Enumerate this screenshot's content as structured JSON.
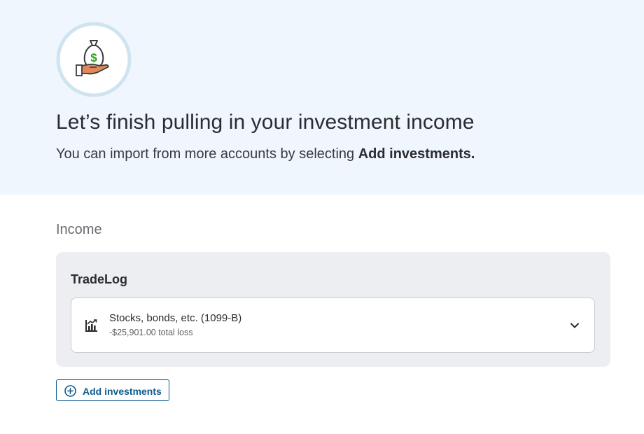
{
  "hero": {
    "icon": "money-bag-hand-icon",
    "title": "Let’s finish pulling in your investment income",
    "subtitle_prefix": "You can import from more accounts by selecting ",
    "subtitle_bold": "Add investments."
  },
  "income": {
    "section_label": "Income",
    "provider": "TradeLog",
    "items": [
      {
        "icon": "stock-chart-icon",
        "title": "Stocks, bonds, etc. (1099-B)",
        "detail": "-$25,901.00 total loss"
      }
    ]
  },
  "actions": {
    "add_investments_label": "Add investments",
    "add_icon": "plus-circle-icon"
  },
  "colors": {
    "hero_bg": "#f0f6fd",
    "card_bg": "#eceef1",
    "accent": "#0d5a8f",
    "money_green": "#2ca01c"
  }
}
